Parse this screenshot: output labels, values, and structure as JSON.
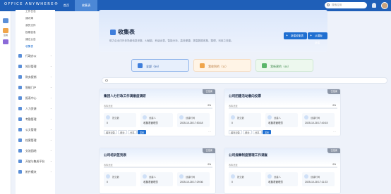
{
  "app": {
    "logo": "OFFICE ANYWHERE®"
  },
  "top_tabs": [
    "首页",
    "收集表"
  ],
  "search": {
    "placeholder": "搜索应用"
  },
  "rail": [
    {
      "color": "#5b8fd8"
    },
    {
      "label": "应用",
      "color": "#f0a54a"
    },
    {
      "color": "#8b6ad8"
    }
  ],
  "sidebar": {
    "sub_items": [
      "工作日志",
      "通讯簿",
      "我的文件",
      "投稿信息",
      "通达公告",
      "收集表"
    ],
    "active_sub": "收集表",
    "groups": [
      "行政办公",
      "知识管理",
      "财务报销",
      "智能门户",
      "报表中心",
      "人力资源",
      "考勤管理",
      "公文管理",
      "档案管理",
      "交流园地",
      "开放与集成平台",
      "附件模块"
    ]
  },
  "header": {
    "title": "收集表",
    "description": "助力企业内外多场景信息采集、AI赋能、秒级出表、智能分析，高效便捷、提高数据收集、整理、利用之效能。",
    "btn_new": "新建收集表",
    "btn_template": "从模板新建"
  },
  "filters": [
    {
      "label": "全部（59）",
      "color": "#3f7edb"
    },
    {
      "label": "我收到的（11）",
      "color": "#f0a54a"
    },
    {
      "label": "我新建的（48）",
      "color": "#5bb66a"
    }
  ],
  "colors": {
    "primary": "#1f6fd1",
    "topbar": "#1f5fb8"
  },
  "card_labels": {
    "progress": "收集进度",
    "submitted": "提交数",
    "creator": "创建人",
    "created_at": "创建时间",
    "records": "填写记录",
    "stats": "统计",
    "more": "···"
  },
  "cards": [
    {
      "title": "集团人力行政工作满意度调研",
      "tag": "已结束",
      "progress": "0%",
      "submitted": "0",
      "creator": "收集表管理员",
      "created_at": "2025-10-28 17:53:18",
      "actions": [
        "填写记录",
        "统计",
        "分享",
        "发布"
      ]
    },
    {
      "title": "公司团建活动意向投票",
      "tag": "已结束",
      "progress": "0%",
      "submitted": "0",
      "creator": "收集表管理员",
      "created_at": "2025-10-28 17:40:15",
      "actions": [
        "填写记录",
        "统计",
        "分享",
        "发布"
      ]
    },
    {
      "title": "公司培训签到表",
      "tag": "已结束",
      "progress": "0%",
      "submitted": "0",
      "creator": "收集表管理员",
      "created_at": "2025-10-28 17:29:36",
      "actions": []
    },
    {
      "title": "公司规章制度管理工作调查",
      "tag": "已结束",
      "progress": "0%",
      "submitted": "0",
      "creator": "收集表管理员",
      "created_at": "2025-10-28 17:11:23",
      "actions": []
    }
  ]
}
